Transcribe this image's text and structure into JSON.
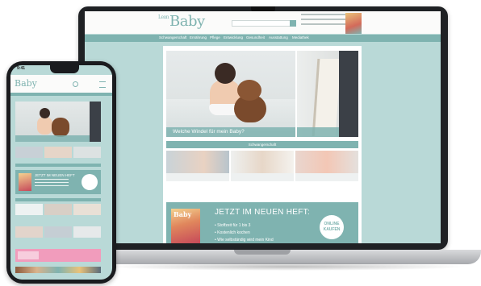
{
  "site": {
    "logo_prefix": "Lean",
    "logo": "Baby",
    "nav": [
      "Schwangerschaft",
      "Ernährung",
      "Pflege",
      "Entwicklung",
      "Gesundheit",
      "Ausstattung",
      "Mediathek"
    ]
  },
  "hero": {
    "caption": "Welche Windel für mein Baby?"
  },
  "section": {
    "title": "Schwangerschaft"
  },
  "issue": {
    "title": "JETZT IM NEUEN HEFT:",
    "bullets": [
      "Stoffzeit für 1 bis 3",
      "Kostenlich kochen",
      "Wie selbständig wird mein Kind"
    ],
    "badge_line1": "ONLINE",
    "badge_line2": "KAUFEN",
    "mag_title": "Baby"
  },
  "phone": {
    "time": "9:41",
    "logo": "Baby",
    "issue_title": "JETZT IM NEUEN HEFT"
  },
  "colors": {
    "teal": "#7fb3b0",
    "light_teal": "#b9d9d7",
    "pink": "#f19cbc"
  }
}
